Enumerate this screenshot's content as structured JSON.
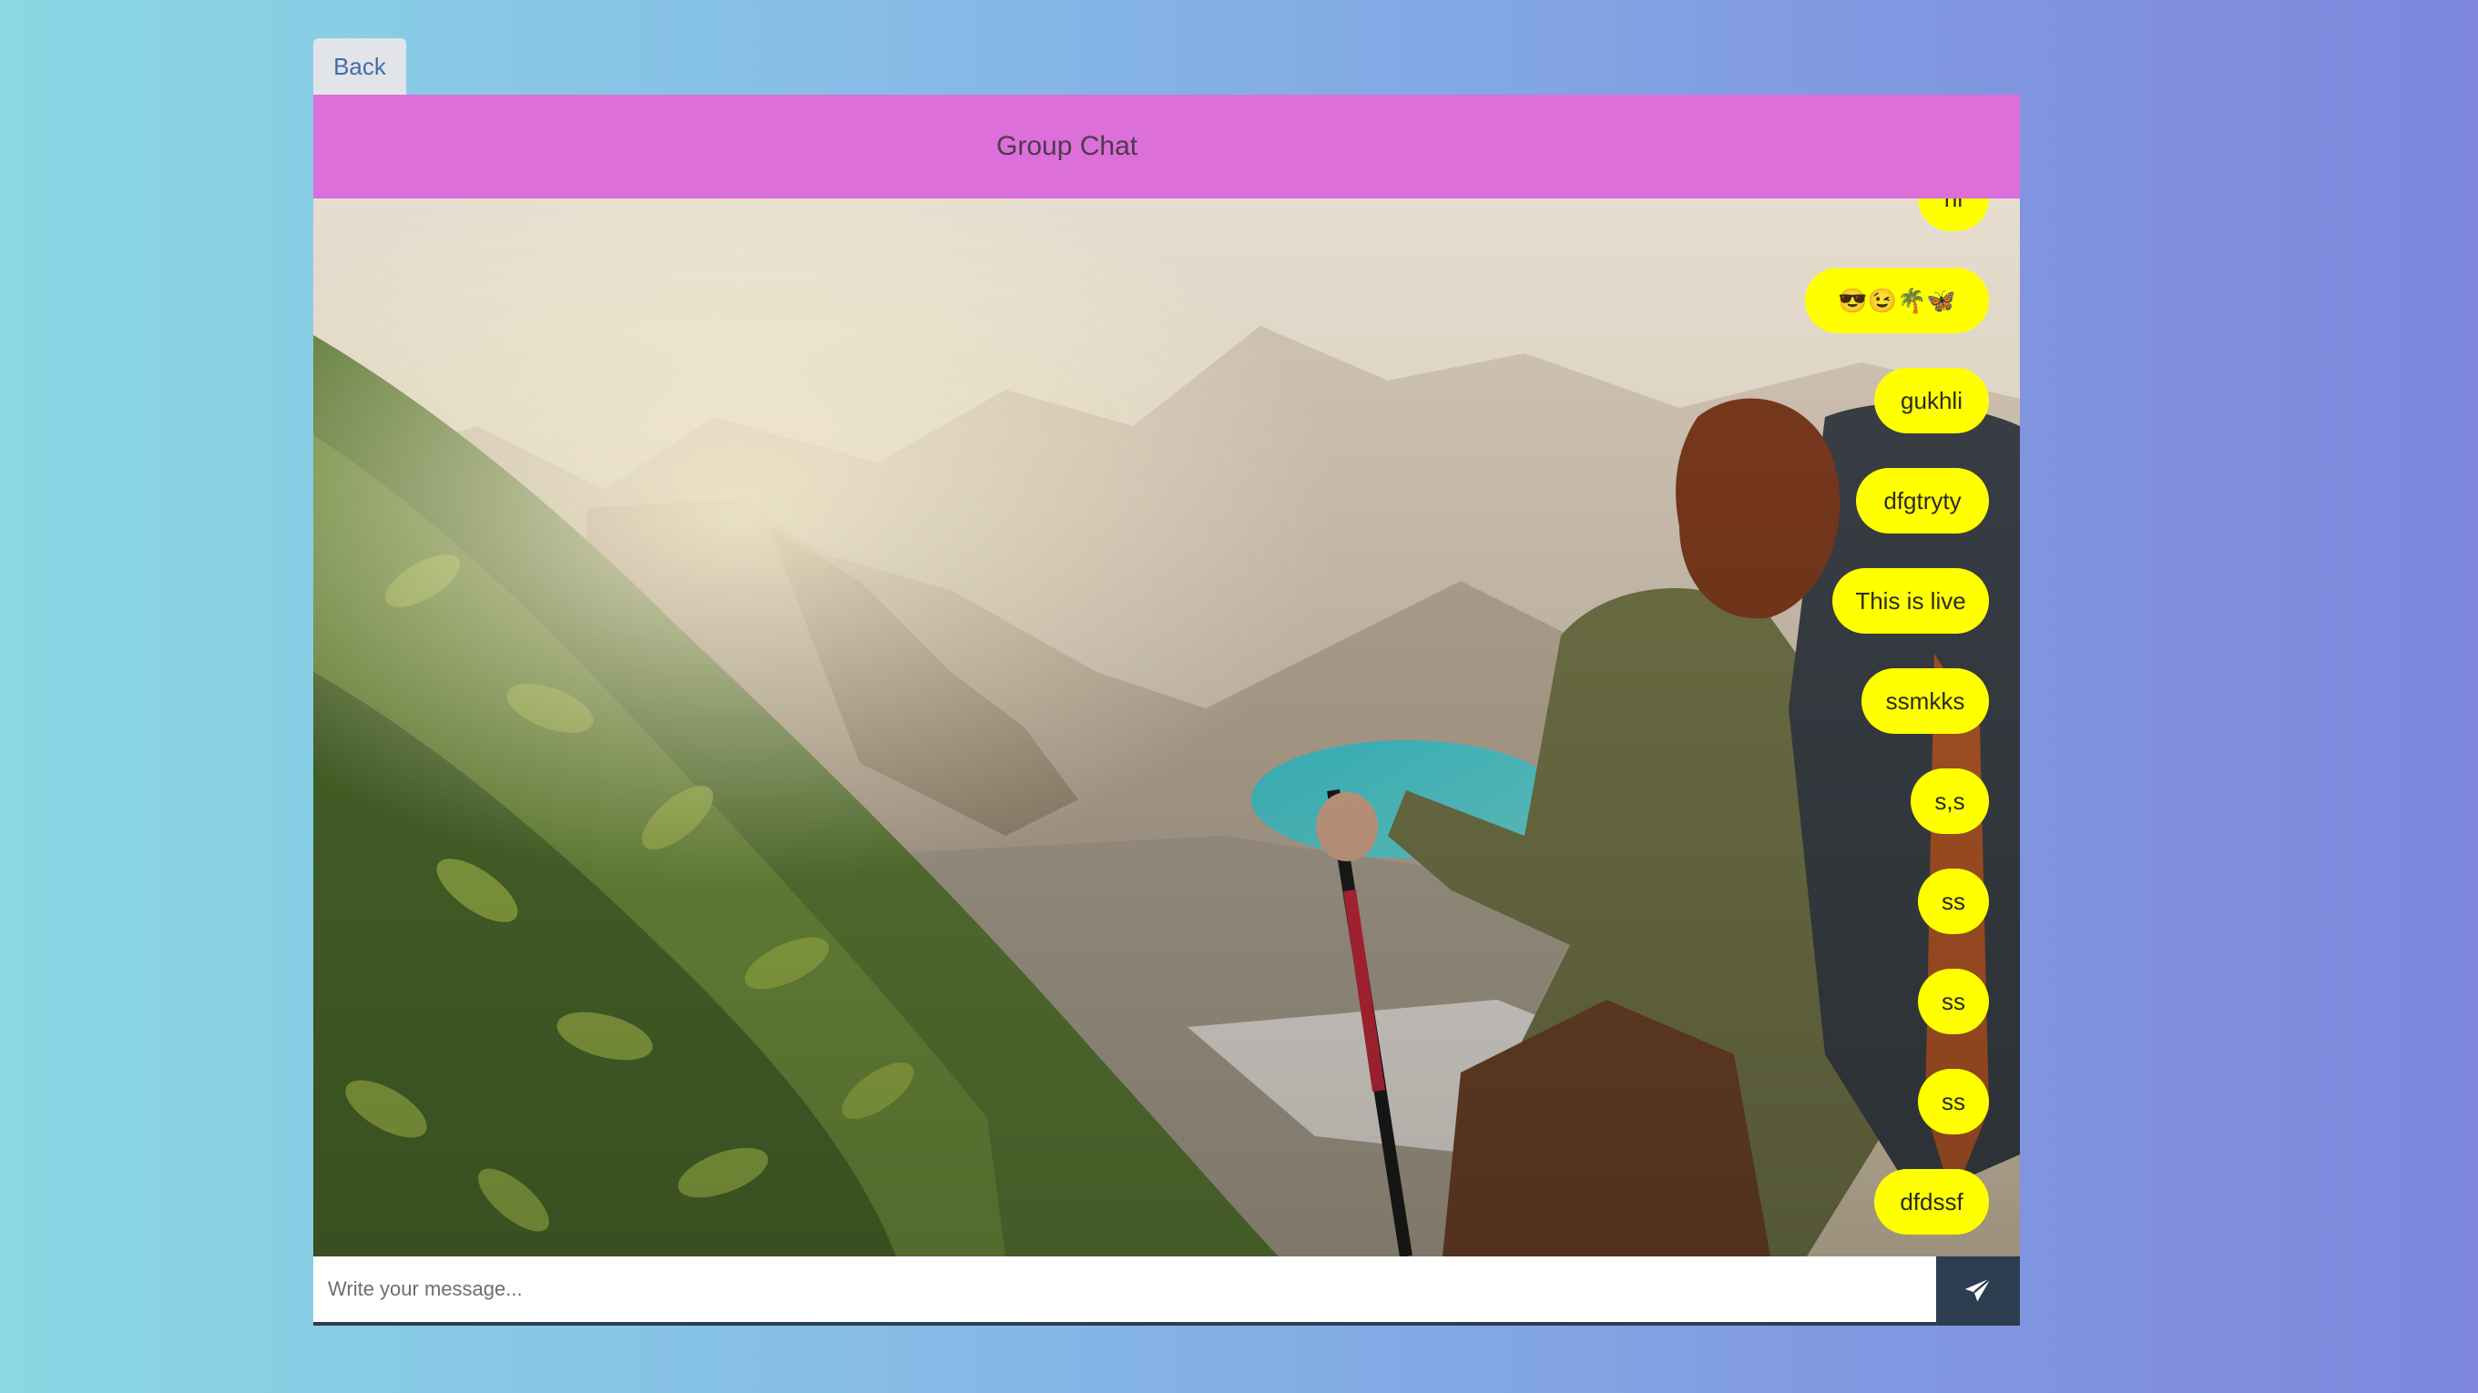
{
  "back_label": "Back",
  "chat": {
    "title": "Group Chat",
    "messages": [
      {
        "text": "hi"
      },
      {
        "text": "😎😉🌴🦋"
      },
      {
        "text": "gukhli"
      },
      {
        "text": "dfgtryty"
      },
      {
        "text": "This is live"
      },
      {
        "text": "ssmkks"
      },
      {
        "text": "s,s"
      },
      {
        "text": "ss"
      },
      {
        "text": "ss"
      },
      {
        "text": "ss"
      },
      {
        "text": "dfdssf"
      }
    ],
    "bubble_color": "#ffff00",
    "header_color": "#dc6fd9"
  },
  "composer": {
    "placeholder": "Write your message...",
    "value": "",
    "send_icon": "send-icon"
  }
}
